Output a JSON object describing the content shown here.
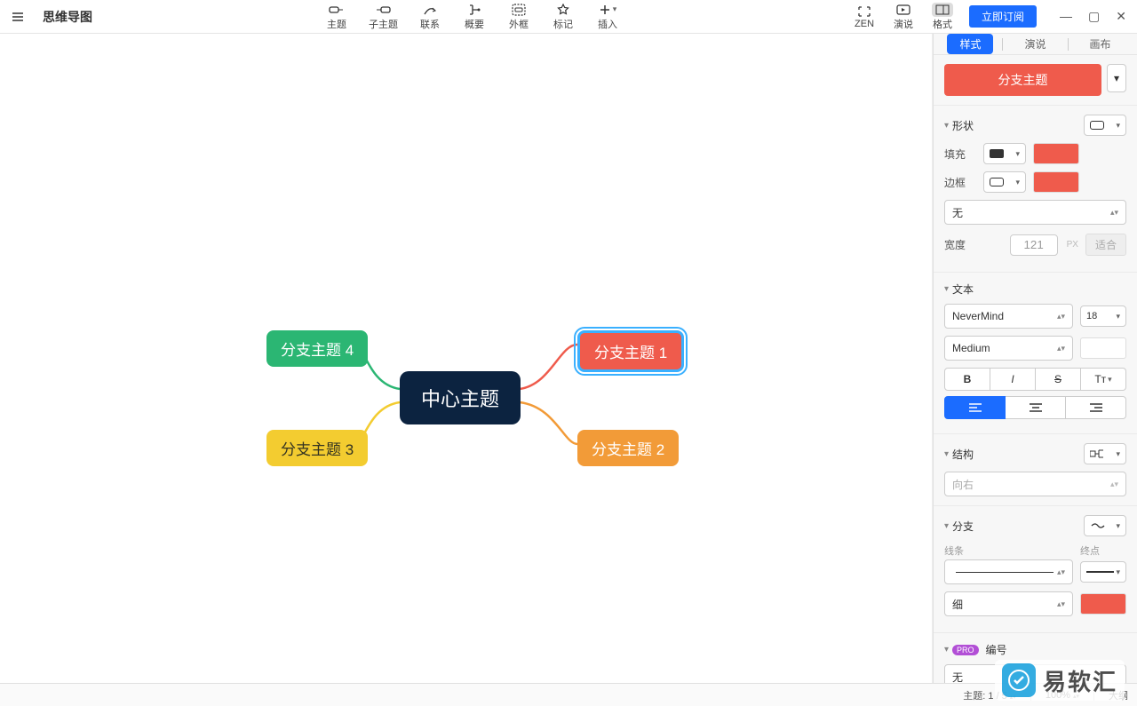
{
  "titlebar": {
    "app_title": "思维导图",
    "tools": {
      "topic": "主题",
      "subtopic": "子主题",
      "link": "联系",
      "summary": "概要",
      "boundary": "外框",
      "marker": "标记",
      "insert": "插入"
    },
    "right": {
      "zen": "ZEN",
      "present": "演说",
      "format": "格式",
      "subscribe": "立即订阅"
    }
  },
  "mindmap": {
    "center": "中心主题",
    "branch1": "分支主题 1",
    "branch2": "分支主题 2",
    "branch3": "分支主题 3",
    "branch4": "分支主题 4"
  },
  "panel": {
    "tabs": {
      "style": "样式",
      "present": "演说",
      "canvas": "画布"
    },
    "topic_type_label": "分支主题",
    "shape": {
      "title": "形状",
      "fill": "填充",
      "border": "边框",
      "none": "无",
      "width": "宽度",
      "width_val": "121",
      "px": "PX",
      "fit": "适合"
    },
    "text": {
      "title": "文本",
      "font": "NeverMind",
      "size": "18",
      "weight": "Medium",
      "bold": "B",
      "italic": "I",
      "strike": "S",
      "case": "Tт"
    },
    "structure": {
      "title": "结构",
      "direction": "向右"
    },
    "branch": {
      "title": "分支",
      "line_lbl": "线条",
      "end_lbl": "终点",
      "thin": "细"
    },
    "numbering": {
      "title": "编号",
      "none": "无",
      "pro": "PRO"
    }
  },
  "status": {
    "topics_label": "主题:",
    "topics_val": "1 / 5",
    "zoom": "100%",
    "outline": "大纲"
  },
  "watermark": "易软汇"
}
